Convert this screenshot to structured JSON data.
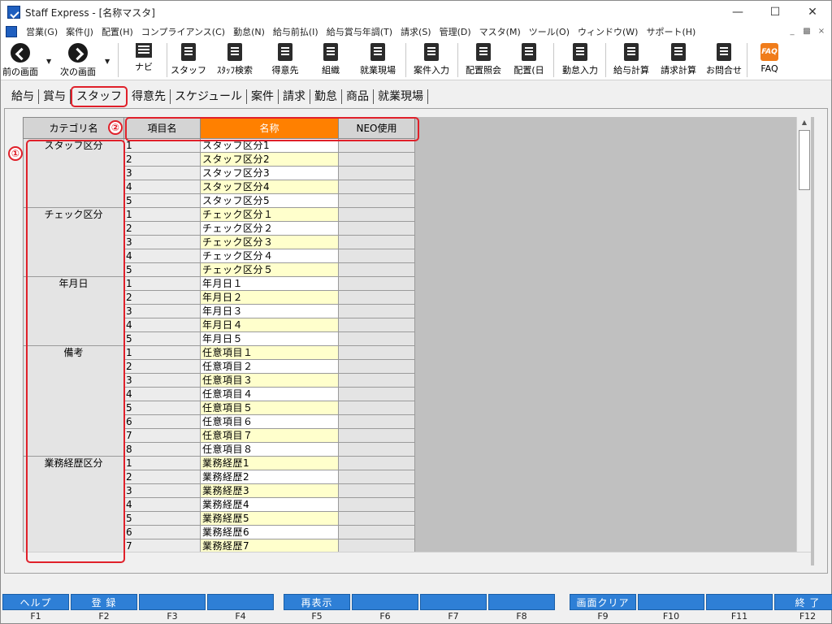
{
  "window": {
    "title": "Staff Express - [名称マスタ]"
  },
  "menu": [
    "営業(G)",
    "案件(J)",
    "配置(H)",
    "コンプライアンス(C)",
    "勤怠(N)",
    "給与前払(I)",
    "給与賞与年調(T)",
    "請求(S)",
    "管理(D)",
    "マスタ(M)",
    "ツール(O)",
    "ウィンドウ(W)",
    "サポート(H)"
  ],
  "toolbar": {
    "prev": "前の画面",
    "next": "次の画面",
    "navi": "ナビ",
    "staff": "スタッフ",
    "staff_search": "ｽﾀｯﾌ検索",
    "client": "得意先",
    "org": "組織",
    "worksite": "就業現場",
    "case_input": "案件入力",
    "assign_inquiry": "配置照会",
    "assign_day": "配置(日",
    "attendance": "勤怠入力",
    "pay_calc": "給与計算",
    "bill_calc": "請求計算",
    "contact": "お問合せ",
    "faq": "FAQ"
  },
  "tabs": [
    "給与",
    "賞与",
    "スタッフ",
    "得意先",
    "スケジュール",
    "案件",
    "請求",
    "勤怠",
    "商品",
    "就業現場"
  ],
  "active_tab": "スタッフ",
  "grid": {
    "headers": {
      "category": "カテゴリ名",
      "item": "項目名",
      "name": "名称",
      "neo": "NEO使用"
    },
    "groups": [
      {
        "category": "スタッフ区分",
        "rows": [
          {
            "num": "1",
            "name": "スタッフ区分1"
          },
          {
            "num": "2",
            "name": "スタッフ区分2"
          },
          {
            "num": "3",
            "name": "スタッフ区分3"
          },
          {
            "num": "4",
            "name": "スタッフ区分4"
          },
          {
            "num": "5",
            "name": "スタッフ区分5"
          }
        ]
      },
      {
        "category": "チェック区分",
        "rows": [
          {
            "num": "1",
            "name": "チェック区分１"
          },
          {
            "num": "2",
            "name": "チェック区分２"
          },
          {
            "num": "3",
            "name": "チェック区分３"
          },
          {
            "num": "4",
            "name": "チェック区分４"
          },
          {
            "num": "5",
            "name": "チェック区分５"
          }
        ]
      },
      {
        "category": "年月日",
        "rows": [
          {
            "num": "1",
            "name": "年月日１"
          },
          {
            "num": "2",
            "name": "年月日２"
          },
          {
            "num": "3",
            "name": "年月日３"
          },
          {
            "num": "4",
            "name": "年月日４"
          },
          {
            "num": "5",
            "name": "年月日５"
          }
        ]
      },
      {
        "category": "備考",
        "rows": [
          {
            "num": "1",
            "name": "任意項目１"
          },
          {
            "num": "2",
            "name": "任意項目２"
          },
          {
            "num": "3",
            "name": "任意項目３"
          },
          {
            "num": "4",
            "name": "任意項目４"
          },
          {
            "num": "5",
            "name": "任意項目５"
          },
          {
            "num": "6",
            "name": "任意項目６"
          },
          {
            "num": "7",
            "name": "任意項目７"
          },
          {
            "num": "8",
            "name": "任意項目８"
          }
        ]
      },
      {
        "category": "業務経歴区分",
        "rows": [
          {
            "num": "1",
            "name": "業務経歴1"
          },
          {
            "num": "2",
            "name": "業務経歴2"
          },
          {
            "num": "3",
            "name": "業務経歴3"
          },
          {
            "num": "4",
            "name": "業務経歴4"
          },
          {
            "num": "5",
            "name": "業務経歴5"
          },
          {
            "num": "6",
            "name": "業務経歴6"
          },
          {
            "num": "7",
            "name": "業務経歴7"
          }
        ]
      }
    ]
  },
  "annotations": {
    "one": "①",
    "two": "②"
  },
  "fkeys": [
    {
      "label": "ヘルプ",
      "key": "F1"
    },
    {
      "label": "登 録",
      "key": "F2"
    },
    {
      "label": "",
      "key": "F3"
    },
    {
      "label": "",
      "key": "F4"
    },
    {
      "label": "再表示",
      "key": "F5"
    },
    {
      "label": "",
      "key": "F6"
    },
    {
      "label": "",
      "key": "F7"
    },
    {
      "label": "",
      "key": "F8"
    },
    {
      "label": "画面クリア",
      "key": "F9"
    },
    {
      "label": "",
      "key": "F10"
    },
    {
      "label": "",
      "key": "F11"
    },
    {
      "label": "終 了",
      "key": "F12"
    }
  ],
  "colors": {
    "accent_orange": "#ff8000",
    "fkey_blue": "#2e7fd6",
    "highlight_yellow": "#ffffcc",
    "annotation_red": "#e0202a"
  }
}
